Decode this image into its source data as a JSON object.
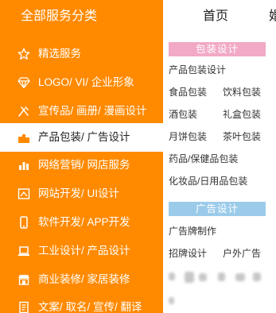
{
  "header": {
    "category_title": "全部服务分类",
    "nav_home": "首页",
    "nav_next": "婚"
  },
  "colors": {
    "accent": "#ff8a00",
    "section_pink": "#f2a9c6",
    "section_blue": "#9ccbea"
  },
  "sidebar": {
    "items": [
      {
        "label": "精选服务",
        "icon": "star-icon"
      },
      {
        "label": "LOGO/ VI/ 企业形象",
        "icon": "diamond-icon"
      },
      {
        "label": "宣传品/ 画册/ 漫画设计",
        "icon": "pen-icon"
      },
      {
        "label": "产品包装/ 广告设计",
        "icon": "box-icon",
        "active": true
      },
      {
        "label": "网络营销/ 网店服务",
        "icon": "bar-chart-icon"
      },
      {
        "label": "网站开发/ UI设计",
        "icon": "design-icon"
      },
      {
        "label": "软件开发/ APP开发",
        "icon": "phone-icon"
      },
      {
        "label": "工业设计/ 产品设计",
        "icon": "laptop-icon"
      },
      {
        "label": "商业装修/ 家居装修",
        "icon": "shop-icon"
      },
      {
        "label": "文案/ 取名/ 宣传/ 翻译",
        "icon": "document-icon"
      }
    ]
  },
  "panel": {
    "packaging": {
      "title": "包装设计",
      "links": [
        "产品包装设计",
        "食品包装",
        "饮料包装",
        "酒包装",
        "礼盒包装",
        "月饼包装",
        "茶叶包装",
        "药品/保健品包装",
        "化妆品/日用品包装"
      ]
    },
    "advertising": {
      "title": "广告设计",
      "links": [
        "广告牌制作",
        "招牌设计",
        "户外广告"
      ]
    }
  }
}
